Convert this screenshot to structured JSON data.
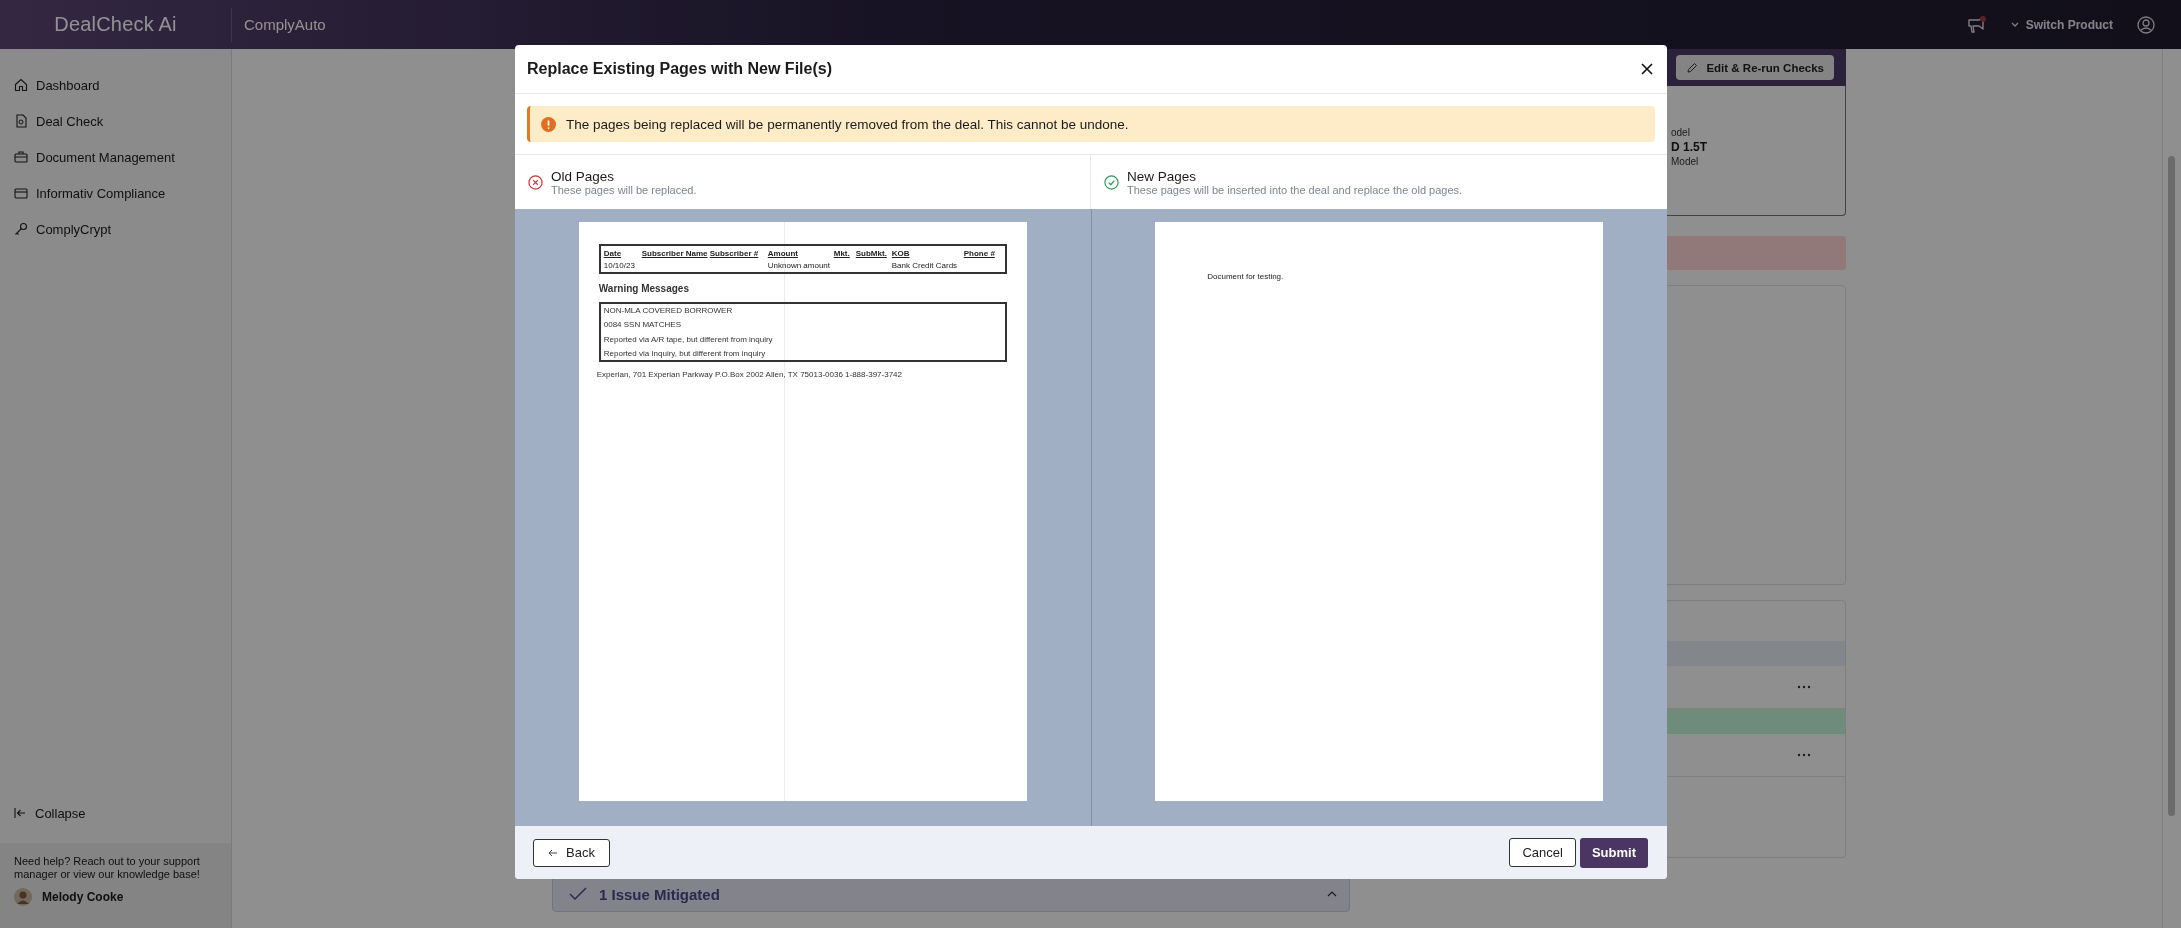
{
  "topbar": {
    "logo": "DealCheck Ai",
    "product": "ComplyAuto",
    "notification": true,
    "switch_product": "Switch Product"
  },
  "sidebar": {
    "items": [
      {
        "label": "Dashboard"
      },
      {
        "label": "Deal Check"
      },
      {
        "label": "Document Management"
      },
      {
        "label": "Informativ Compliance"
      },
      {
        "label": "ComplyCrypt"
      }
    ],
    "collapse": "Collapse",
    "help": "Need help? Reach out to your support manager or view our knowledge base!",
    "user": "Melody Cooke"
  },
  "background": {
    "edit_button": "Edit & Re-run Checks",
    "fields": [
      {
        "kind": "label",
        "text": "odel"
      },
      {
        "kind": "value",
        "text": "D 1.5T"
      },
      {
        "kind": "label",
        "text": "Model"
      }
    ],
    "issues": "1 Issue Mitigated"
  },
  "modal": {
    "title": "Replace Existing Pages with New File(s)",
    "warning": "The pages being replaced will be permanently removed from the deal. This cannot be undone.",
    "columns": [
      {
        "kind": "old",
        "title": "Old Pages",
        "subtitle": "These pages will be replaced."
      },
      {
        "kind": "new",
        "title": "New Pages",
        "subtitle": "These pages will be inserted into the deal and replace the old pages."
      }
    ],
    "old_page": {
      "table_columns": [
        {
          "header": "Date",
          "value": "10/10/23"
        },
        {
          "header": "Subscriber Name"
        },
        {
          "header": "Subscriber #"
        },
        {
          "header": "Amount",
          "value": "Unknown amount"
        },
        {
          "header": "Mkt."
        },
        {
          "header": "SubMkt."
        },
        {
          "header": "KOB",
          "value": "Bank Credit Cards"
        },
        {
          "header": "Phone #"
        }
      ],
      "section_title": "Warning Messages",
      "messages": [
        "NON-MLA COVERED BORROWER",
        "0084 SSN MATCHES",
        "Reported via A/R tape, but different from inquiry",
        "Reported via Inquiry, but different from inquiry"
      ],
      "footer": "Experian, 701 Experian Parkway P.O.Box 2002 Allen, TX 75013-0036 1-888-397-3742"
    },
    "new_page": {
      "text": "Document for testing."
    },
    "back": "Back",
    "cancel": "Cancel",
    "submit": "Submit"
  }
}
